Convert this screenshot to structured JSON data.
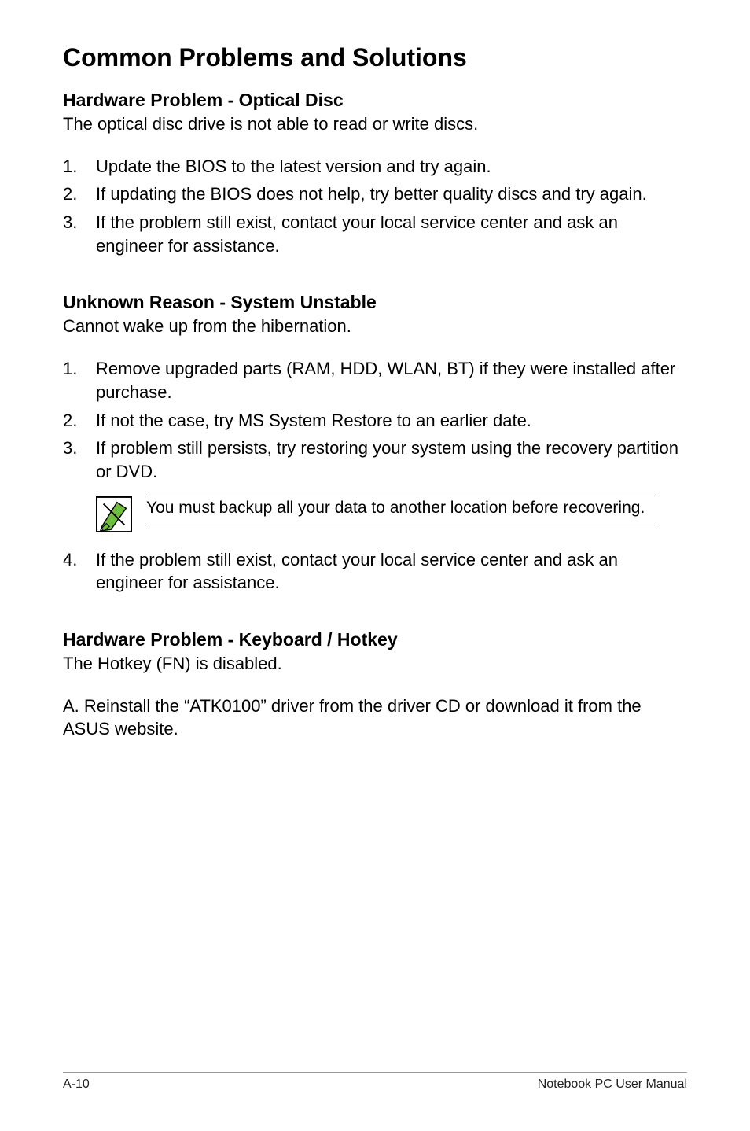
{
  "title": "Common Problems and Solutions",
  "section1": {
    "heading": "Hardware Problem - Optical Disc",
    "subtitle": "The optical disc drive is not able to read or write discs.",
    "items": [
      "Update the BIOS to the latest version and try again.",
      "If updating the BIOS does not help, try better quality discs and try again.",
      "If the problem still exist, contact your local service center and ask an engineer for assistance."
    ]
  },
  "section2": {
    "heading": "Unknown Reason - System Unstable",
    "subtitle": "Cannot wake up from the hibernation.",
    "items_a": [
      "Remove upgraded parts (RAM, HDD, WLAN, BT) if they were installed after purchase.",
      "If not the case, try MS System Restore to an earlier date.",
      "If problem still persists, try restoring your system using the recovery partition or DVD."
    ],
    "note": "You must backup all your data to another location before recovering.",
    "items_b": [
      "If the problem still exist, contact your local service center and ask an engineer for assistance."
    ]
  },
  "section3": {
    "heading": "Hardware Problem - Keyboard / Hotkey",
    "subtitle": "The Hotkey (FN) is disabled.",
    "step": "A. Reinstall the “ATK0100” driver from the driver CD or download it from the ASUS website."
  },
  "footer": {
    "page": "A-10",
    "doc": "Notebook PC User Manual"
  }
}
